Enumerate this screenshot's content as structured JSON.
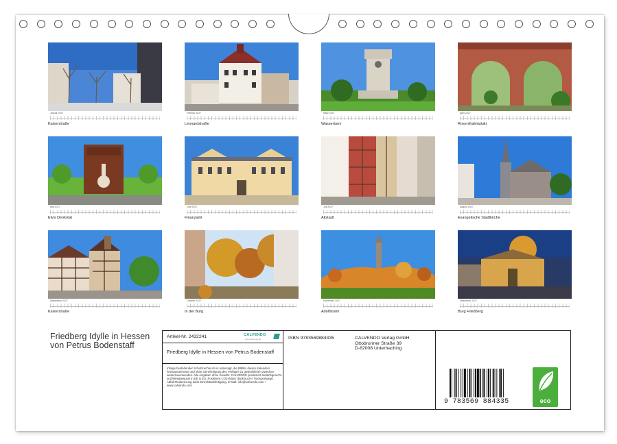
{
  "calendar": {
    "months": [
      {
        "month": "Januar 2027",
        "caption": "Kaiserstraße",
        "scene": "street-winter"
      },
      {
        "month": "Februar 2027",
        "caption": "Leonardstraße",
        "scene": "villa"
      },
      {
        "month": "März 2027",
        "caption": "Wasserturm",
        "scene": "tower"
      },
      {
        "month": "April 2027",
        "caption": "Rosenthalviadukt",
        "scene": "viaduct"
      },
      {
        "month": "Mai 2027",
        "caption": "Elvis Denkmal",
        "scene": "monument"
      },
      {
        "month": "Juni 2027",
        "caption": "Finanzamt",
        "scene": "palace"
      },
      {
        "month": "Juli 2027",
        "caption": "Altstadt",
        "scene": "alley"
      },
      {
        "month": "August 2027",
        "caption": "Evangelische Stadtkirche",
        "scene": "church"
      },
      {
        "month": "September 2027",
        "caption": "Kaiserstraße",
        "scene": "halftimber"
      },
      {
        "month": "Oktober 2027",
        "caption": "In der Burg",
        "scene": "autumn"
      },
      {
        "month": "November 2027",
        "caption": "Adolfsturm",
        "scene": "hilltower"
      },
      {
        "month": "Dezember 2027",
        "caption": "Burg Friedberg",
        "scene": "night"
      }
    ]
  },
  "back": {
    "title": "Friedberg  Idylle in Hessen von Petrus Bodenstaff",
    "article": "Artikel-Nr. 2432241",
    "brand": "CALVENDO",
    "brand_sub": "www.calvendo.de",
    "product_title": "Friedberg  Idylle in Hessen von Petrus Bodenstaff",
    "legal": "Infolge bestehender Schutzrechte ist es untersagt, die Blätter dieses Kalenders herauszutrennen und ohne Genehmigung des Verlages zu gewerblichen Zwecken weiterzuverwenden. Alle Angaben ohne Gewähr. CALVENDO produziert bedarfsgerecht und klimabewusst in DE & EU. Positivere CO2-Bilanz dank kurzer Transportwege. Abfall-Reduzierung dank Einzelstückfertigung. E-Mail: info@calvendo.com • www.calvendo.com",
    "isbn": "ISBN 9783569884335",
    "publisher_lines": [
      "CALVENDO Verlag GmbH",
      "Ottobrunner Straße 39",
      "D-82008 Unterhaching"
    ],
    "barcode_number": "9 783569 884335",
    "eco_label": "eco"
  }
}
